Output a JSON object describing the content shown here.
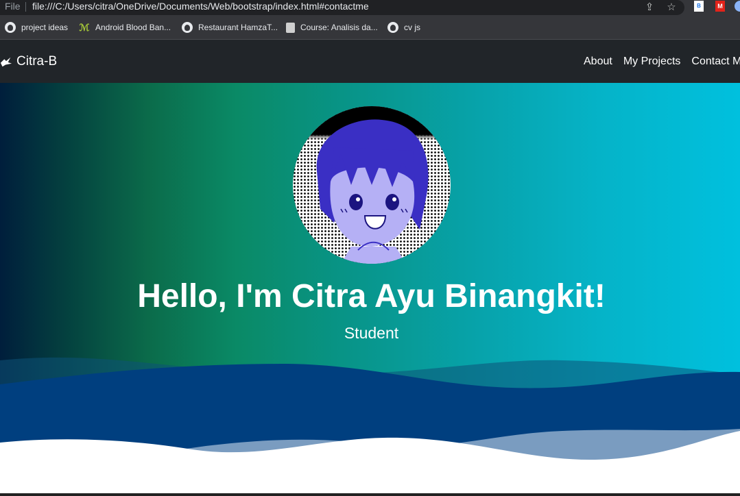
{
  "browser": {
    "file_label": "File",
    "url": "file:///C:/Users/citra/OneDrive/Documents/Web/bootstrap/index.html#contactme",
    "extensions": [
      "B",
      "M"
    ]
  },
  "bookmarks": [
    {
      "label": "project ideas",
      "icon": "github-icon"
    },
    {
      "label": "Android Blood Ban...",
      "icon": "android-icon"
    },
    {
      "label": "Restaurant HamzaT...",
      "icon": "github-icon"
    },
    {
      "label": "Course: Analisis da...",
      "icon": "course-icon"
    },
    {
      "label": "cv js",
      "icon": "github-icon"
    }
  ],
  "navbar": {
    "brand": "Citra-B",
    "links": [
      "About",
      "My Projects",
      "Contact Me"
    ]
  },
  "hero": {
    "title": "Hello, I'm Citra Ayu Binangkit!",
    "subtitle": "Student"
  },
  "colors": {
    "navbar_bg": "#212529",
    "gradient_start": "#001e3c",
    "gradient_end": "#00c0de",
    "wave_dark": "#003f7f",
    "wave_light": "#7a9cc0"
  }
}
